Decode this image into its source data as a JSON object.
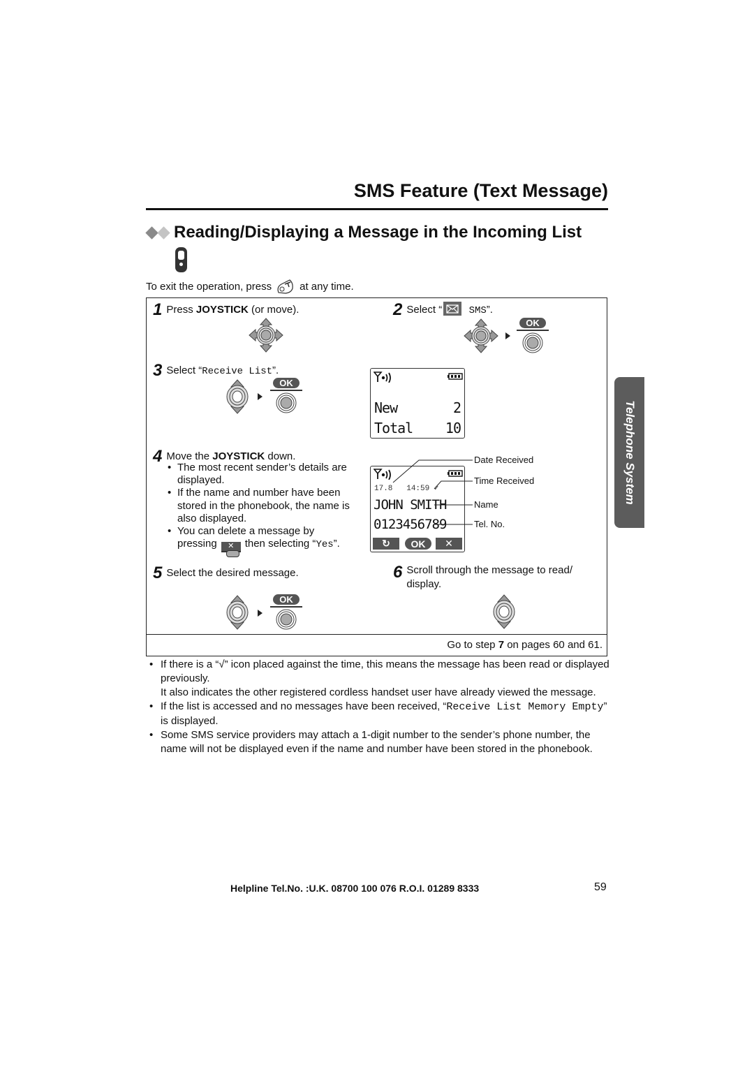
{
  "page": {
    "title": "SMS Feature (Text Message)",
    "section_title": "Reading/Displaying a Message in the Incoming List",
    "exit_instruction": {
      "before": "To exit the operation, press",
      "after": "at any time."
    },
    "side_tab": "Telephone System",
    "footer": {
      "helpline": "Helpline Tel.No. :U.K. 08700 100 076  R.O.I. 01289 8333",
      "page_number": "59"
    },
    "colors": {
      "diamond_dark": "#8a8a8a",
      "diamond_light": "#c4c4c4",
      "tab": "#5c5c5c",
      "ok_key": "#555555"
    }
  },
  "steps": [
    {
      "num": "1",
      "text_before": "Press ",
      "bold": "JOYSTICK",
      "text_after": " (or move)."
    },
    {
      "num": "2",
      "text_before": "Select “",
      "mono": "SMS",
      "text_after": "”."
    },
    {
      "num": "3",
      "text_before": "Select “",
      "mono": "Receive List",
      "text_after": "”."
    },
    {
      "num": "4",
      "text_before": "Move the ",
      "bold": "JOYSTICK",
      "text_after": " down.",
      "bullets": [
        "The most recent sender’s details are displayed.",
        "If the name and number have been stored in the phonebook, the name is also displayed."
      ],
      "delete_bullet": {
        "before": "You can delete a message by",
        "pressing": "pressing",
        "then": "then selecting “",
        "mono": "Yes",
        "end": "”."
      }
    },
    {
      "num": "5",
      "text": "Select the desired message."
    },
    {
      "num": "6",
      "text": "Scroll through the message to read/ display."
    }
  ],
  "ok_label": "OK",
  "lcd_summary": {
    "rows": [
      {
        "label": "New",
        "value": "2"
      },
      {
        "label": "Total",
        "value": "10"
      }
    ]
  },
  "lcd_detail": {
    "date": "17.8",
    "time": "14:59",
    "read_mark": "✓",
    "name": "JOHN SMITH",
    "tel": "0123456789",
    "softkeys": [
      "↻",
      "OK",
      "✕"
    ],
    "callouts": [
      "Date Received",
      "Time Received",
      "Name",
      "Tel. No."
    ]
  },
  "goto": {
    "before": "Go to step ",
    "step": "7",
    "after": " on pages 60 and 61."
  },
  "notes": {
    "n1_before": "If there is a “",
    "n1_icon": "√",
    "n1_after": "” icon placed against the time, this means the message has been read or displayed previously.",
    "n1_cont": "It also indicates the other registered cordless handset user have already viewed the message.",
    "n2_before": "If the list is accessed and no messages have been received, “",
    "n2_mono": "Receive List Memory Empty",
    "n2_after": "” is displayed.",
    "n3": "Some SMS service providers may attach a 1-digit number to the sender’s phone number, the name will not be displayed even if the name and number have been stored in the phonebook."
  }
}
